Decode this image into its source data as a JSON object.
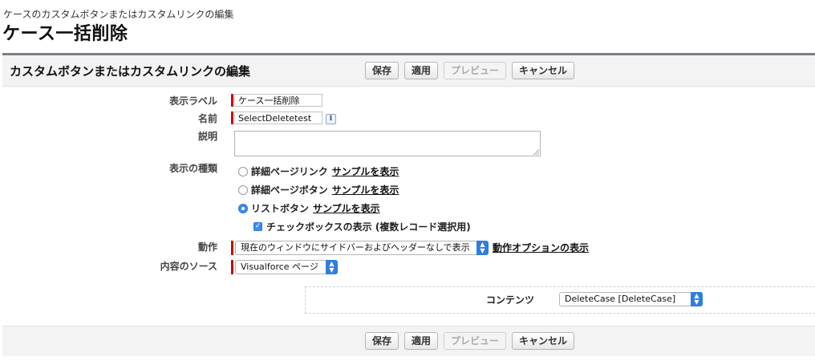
{
  "header": {
    "breadcrumb": "ケースのカスタムボタンまたはカスタムリンクの編集",
    "title": "ケース一括削除"
  },
  "panel": {
    "title": "カスタムボタンまたはカスタムリンクの編集"
  },
  "buttons": {
    "save": "保存",
    "apply": "適用",
    "preview": "プレビュー",
    "cancel": "キャンセル"
  },
  "form": {
    "display_label": {
      "label": "表示ラベル",
      "value": "ケース一括削除"
    },
    "name": {
      "label": "名前",
      "value": "SelectDeletetest",
      "info_icon": "i"
    },
    "description": {
      "label": "説明",
      "value": ""
    },
    "display_type": {
      "label": "表示の種類",
      "options": [
        {
          "label": "詳細ページリンク",
          "link": "サンプルを表示",
          "checked": false
        },
        {
          "label": "詳細ページボタン",
          "link": "サンプルを表示",
          "checked": false
        },
        {
          "label": "リストボタン",
          "link": "サンプルを表示",
          "checked": true
        }
      ],
      "checkbox_label": "チェックボックスの表示 (複数レコード選択用)",
      "checkbox_checked": true
    },
    "behavior": {
      "label": "動作",
      "selected": "現在のウィンドウにサイドバーおよびヘッダーなしで表示",
      "link": "動作オプションの表示"
    },
    "content_source": {
      "label": "内容のソース",
      "selected": "Visualforce ページ"
    },
    "content": {
      "label": "コンテンツ",
      "selected": "DeleteCase [DeleteCase]"
    }
  },
  "colors": {
    "required": "#cc0000",
    "accent": "#2f7de1",
    "panel_border": "#7a7f88"
  }
}
